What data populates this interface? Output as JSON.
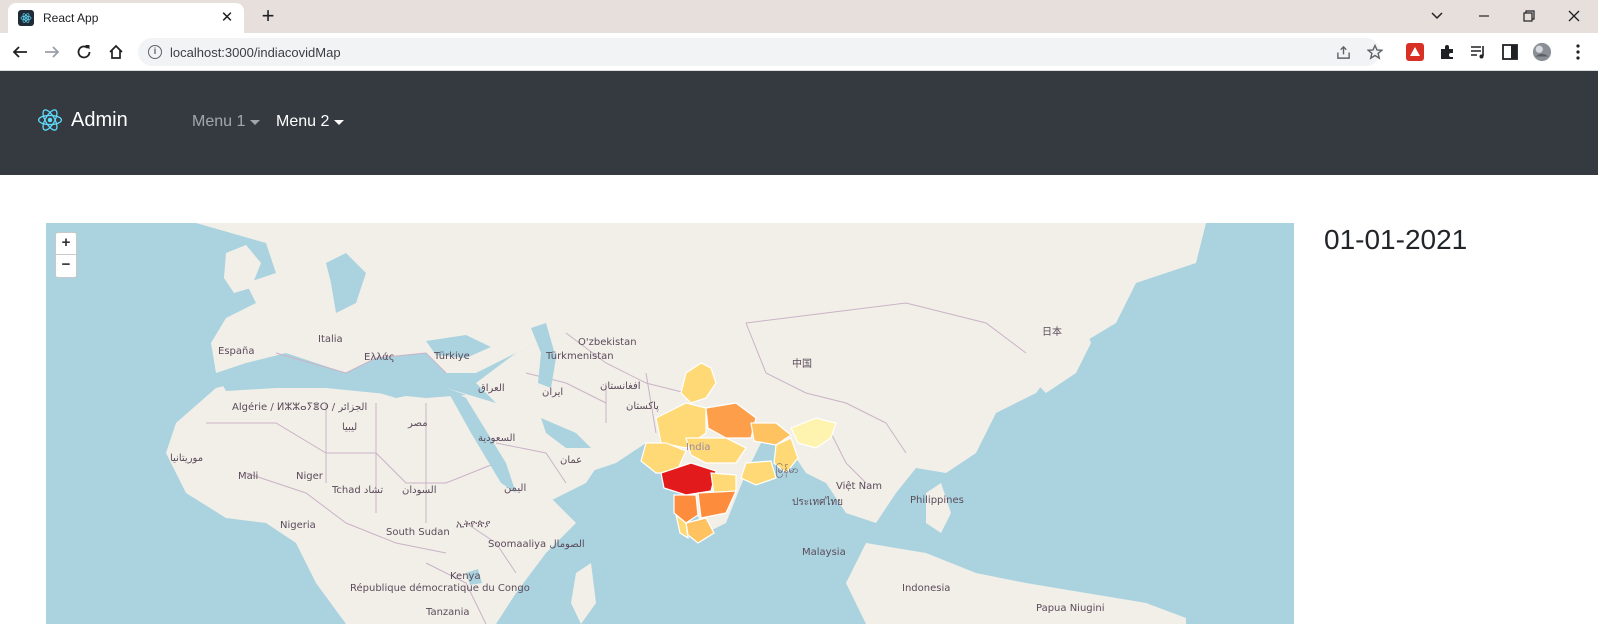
{
  "browser": {
    "tab_title": "React App",
    "new_tab": "+",
    "url": "localhost:3000/indiacovidMap"
  },
  "navbar": {
    "brand": "Admin",
    "menus": [
      {
        "label": "Menu 1"
      },
      {
        "label": "Menu 2"
      }
    ]
  },
  "map": {
    "zoom_in": "+",
    "zoom_out": "−",
    "labels": [
      "España",
      "Italia",
      "Ελλάς",
      "Türkiye",
      "Türkmenistan",
      "O'zbekistan",
      "中国",
      "日本",
      "Algérie / ⵍⵣⵣⴰⵢⴻⵔ / الجزائر",
      "ليبيا",
      "مصر",
      "العراق",
      "ایران",
      "افغانستان",
      "پاکستان",
      "السعودية",
      "عمان",
      "اليمن",
      "موريتانيا",
      "Mali",
      "Niger",
      "Tchad تشاد",
      "السودان",
      "Nigeria",
      "South Sudan",
      "ኢትዮጵያ",
      "Soomaaliya الصومال",
      "Kenya",
      "République démocratique du Congo",
      "Tanzania",
      "မြန်မာ",
      "ประเทศไทย",
      "Việt Nam",
      "Philippines",
      "Malaysia",
      "Indonesia",
      "Papua Niugini",
      "India"
    ],
    "choropleth_colors": {
      "low": "#fed976",
      "mid": "#fd8d3c",
      "high": "#e31a1c"
    }
  },
  "date": "01-01-2021"
}
